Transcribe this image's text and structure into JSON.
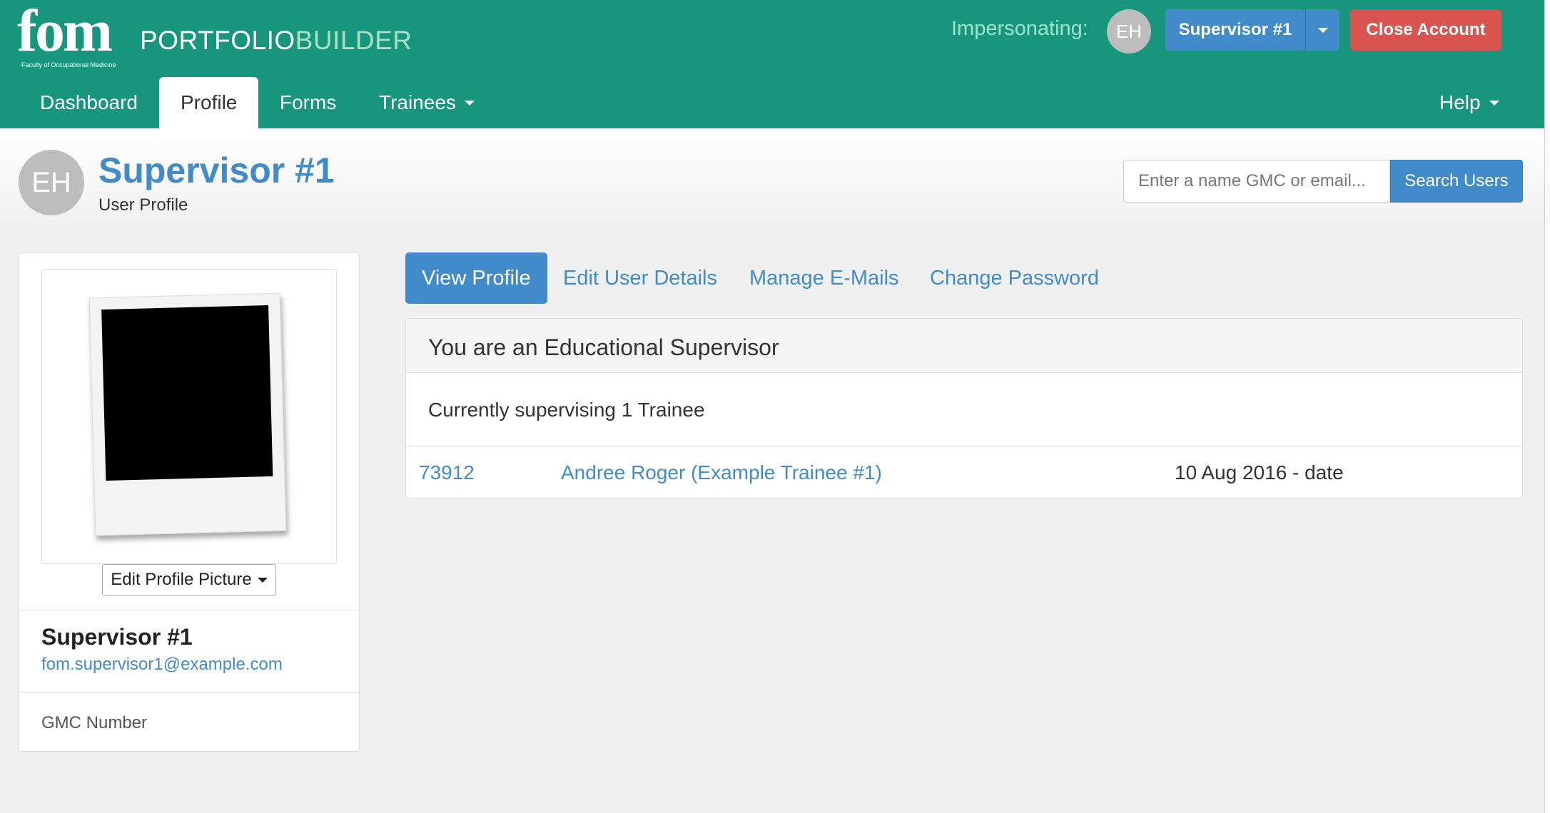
{
  "header": {
    "logo_text": "fom",
    "logo_subtext": "Faculty of Occupational Medicine",
    "brand_part1": "PORTFOLIO",
    "brand_part2": "BUILDER",
    "impersonating_label": "Impersonating:",
    "impersonated_initials": "EH",
    "user_button_label": "Supervisor #1",
    "close_account_label": "Close Account",
    "colors": {
      "bar": "#18967d",
      "primary": "#428bca",
      "danger": "#d9534f"
    }
  },
  "nav": {
    "items": [
      {
        "label": "Dashboard"
      },
      {
        "label": "Profile",
        "active": true
      },
      {
        "label": "Forms"
      },
      {
        "label": "Trainees",
        "dropdown": true
      }
    ],
    "help_label": "Help"
  },
  "page_header": {
    "avatar_initials": "EH",
    "title": "Supervisor #1",
    "subtitle": "User Profile",
    "search_placeholder": "Enter a name GMC or email...",
    "search_button": "Search Users"
  },
  "profile_card": {
    "edit_picture_label": "Edit Profile Picture",
    "name": "Supervisor #1",
    "email": "fom.supervisor1@example.com",
    "gmc_label": "GMC Number"
  },
  "tabs": [
    {
      "label": "View Profile",
      "active": true
    },
    {
      "label": "Edit User Details"
    },
    {
      "label": "Manage E-Mails"
    },
    {
      "label": "Change Password"
    }
  ],
  "panel": {
    "title": "You are an Educational Supervisor",
    "summary": "Currently supervising 1 Trainee",
    "trainees": [
      {
        "id": "73912",
        "name": "Andree Roger (Example Trainee #1)",
        "dates": "10 Aug 2016 - date"
      }
    ]
  }
}
